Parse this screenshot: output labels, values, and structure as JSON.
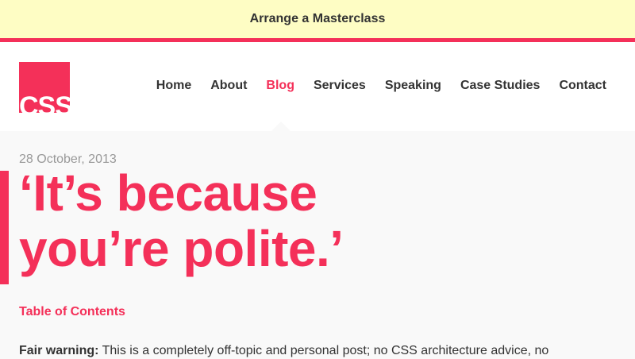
{
  "banner": {
    "label": "Arrange a Masterclass"
  },
  "logo": {
    "text": "CSS"
  },
  "nav": {
    "items": [
      {
        "label": "Home"
      },
      {
        "label": "About"
      },
      {
        "label": "Blog"
      },
      {
        "label": "Services"
      },
      {
        "label": "Speaking"
      },
      {
        "label": "Case Studies"
      },
      {
        "label": "Contact"
      }
    ],
    "active": "Blog"
  },
  "post": {
    "date": "28 October, 2013",
    "title_line1": "‘It’s because",
    "title_line2": "you’re polite.’",
    "toc_label": "Table of Contents",
    "warning_label": "Fair warning:",
    "warning_text": " This is a completely off-topic and personal post; no CSS architecture advice, no"
  },
  "colors": {
    "accent": "#f43059",
    "banner_bg": "#fefdc4",
    "page_bg": "#f9f9f9",
    "text": "#333333",
    "muted": "#999999"
  }
}
